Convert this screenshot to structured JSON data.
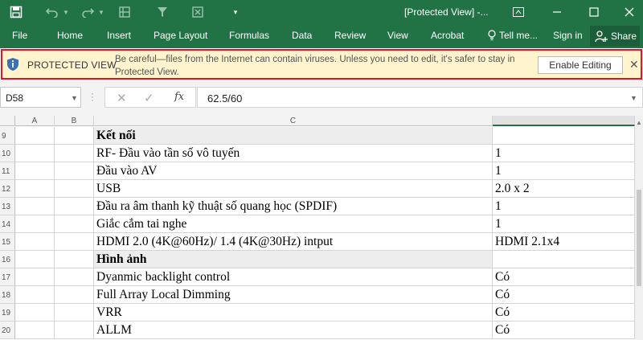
{
  "titlebar": {
    "title": "[Protected View] -...",
    "accent": "#217346"
  },
  "ribbon": {
    "tabs": [
      "File",
      "Home",
      "Insert",
      "Page Layout",
      "Formulas",
      "Data",
      "Review",
      "View",
      "Acrobat"
    ],
    "tell_me": "Tell me...",
    "sign_in": "Sign in",
    "share": "Share"
  },
  "protected_view": {
    "title": "PROTECTED VIEW",
    "message": "Be careful—files from the Internet can contain viruses. Unless you need to edit, it's safer to stay in Protected View.",
    "enable_button": "Enable Editing",
    "close": "✕",
    "bar_color": "#fff4ce",
    "border_color": "#e81123"
  },
  "formula_bar": {
    "name_box": "D58",
    "formula": "62.5/60",
    "fx": "fx"
  },
  "grid": {
    "columns": [
      "A",
      "B",
      "C"
    ],
    "rows": [
      {
        "num": "9",
        "c": "Kết nối",
        "d": "",
        "bold": true,
        "shaded": true
      },
      {
        "num": "10",
        "c": "RF- Đầu vào tần số vô tuyến",
        "d": "1",
        "bold": false,
        "shaded": false
      },
      {
        "num": "11",
        "c": "Đầu vào AV",
        "d": "1",
        "bold": false,
        "shaded": false
      },
      {
        "num": "12",
        "c": "USB",
        "d": "2.0 x 2",
        "bold": false,
        "shaded": false
      },
      {
        "num": "13",
        "c": "Đầu ra âm thanh kỹ thuật số quang học (SPDIF)",
        "d": "1",
        "bold": false,
        "shaded": false
      },
      {
        "num": "14",
        "c": "Giắc cắm tai nghe",
        "d": "1",
        "bold": false,
        "shaded": false
      },
      {
        "num": "15",
        "c": "HDMI 2.0 (4K@60Hz)/ 1.4 (4K@30Hz) intput",
        "d": "HDMI 2.1x4",
        "bold": false,
        "shaded": false
      },
      {
        "num": "16",
        "c": "Hình ảnh",
        "d": "",
        "bold": true,
        "shaded": true
      },
      {
        "num": "17",
        "c": "Dyanmic backlight control",
        "d": "Có",
        "bold": false,
        "shaded": false
      },
      {
        "num": "18",
        "c": "Full Array Local Dimming",
        "d": "Có",
        "bold": false,
        "shaded": false
      },
      {
        "num": "19",
        "c": "VRR",
        "d": "Có",
        "bold": false,
        "shaded": false
      },
      {
        "num": "20",
        "c": "ALLM",
        "d": "Có",
        "bold": false,
        "shaded": false
      }
    ]
  }
}
